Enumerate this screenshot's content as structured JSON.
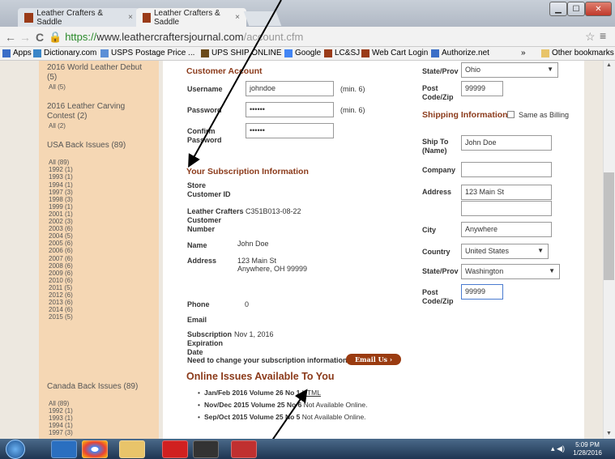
{
  "browser": {
    "tabs": [
      {
        "title": "Leather Crafters & Saddle",
        "close": "×"
      },
      {
        "title": "Leather Crafters & Saddle",
        "close": "×"
      }
    ],
    "nav": {
      "back": "←",
      "forward": "→",
      "reload": "C"
    },
    "url": {
      "scheme": "https://",
      "host": "www.leathercraftersjournal.com",
      "path": "/account.cfm"
    },
    "star": "☆",
    "menu": "≡",
    "bookmarks": [
      {
        "label": "Apps",
        "icon": "apps-icon"
      },
      {
        "label": "Dictionary.com",
        "icon": "dictionary-icon"
      },
      {
        "label": "USPS Postage Price ...",
        "icon": "usps-icon"
      },
      {
        "label": "UPS SHIP ONLINE",
        "icon": "ups-icon"
      },
      {
        "label": "Google",
        "icon": "google-icon"
      },
      {
        "label": "LC&SJ",
        "icon": "lcsj-icon"
      },
      {
        "label": "Web Cart Login",
        "icon": "webcart-icon"
      },
      {
        "label": "Authorize.net",
        "icon": "authorize-icon"
      }
    ],
    "bookmark_overflow": "»",
    "other_bookmarks": "Other bookmarks"
  },
  "sidebar": {
    "groups": [
      {
        "title": "2016 World Leather Debut (5)",
        "items": [
          "All (5)"
        ]
      },
      {
        "title": "2016 Leather Carving Contest (2)",
        "items": [
          "All (2)"
        ]
      },
      {
        "title": "USA Back Issues (89)",
        "items": [
          "All (89)",
          "1992 (1)",
          "1993 (1)",
          "1994 (1)",
          "1997 (3)",
          "1998 (3)",
          "1999 (1)",
          "2001 (1)",
          "2002 (3)",
          "2003 (6)",
          "2004 (5)",
          "2005 (6)",
          "2006 (6)",
          "2007 (6)",
          "2008 (6)",
          "2009 (6)",
          "2010 (6)",
          "2011 (5)",
          "2012 (6)",
          "2013 (6)",
          "2014 (6)",
          "2015 (5)"
        ]
      },
      {
        "title": "Canada Back Issues (89)",
        "items": [
          "All (89)",
          "1992 (1)",
          "1993 (1)",
          "1994 (1)",
          "1997 (3)"
        ]
      }
    ]
  },
  "account": {
    "heading": "Customer Account",
    "username_label": "Username",
    "username_value": "johndoe",
    "username_hint": "(min. 6)",
    "password_label": "Password",
    "password_value": "••••••",
    "password_hint": "(min. 6)",
    "confirm_label": "Confirm Password",
    "confirm_value": "••••••"
  },
  "subscription": {
    "heading": "Your Subscription Information",
    "store_id_label": "Store Customer ID",
    "lc_number_label": "Leather Crafters Customer Number",
    "lc_number_value": "C351B013-08-22",
    "name_label": "Name",
    "name_value": "John Doe",
    "address_label": "Address",
    "address_line1": "123 Main St",
    "address_line2": "Anywhere, OH  99999",
    "phone_label": "Phone",
    "phone_value": "0",
    "email_label": "Email",
    "expiration_label": "Subscription Expiration Date",
    "expiration_value": "Nov 1, 2016",
    "change_prompt": "Need to change your subscription information?",
    "email_button": "Email Us ›"
  },
  "online_issues": {
    "heading": "Online Issues Available To You",
    "items": [
      {
        "title": "Jan/Feb 2016 Volume 26 No 1",
        "status": "HTML",
        "is_link": true
      },
      {
        "title": "Nov/Dec 2015 Volume 25 No 6",
        "status": "Not Available Online.",
        "is_link": false
      },
      {
        "title": "Sep/Oct 2015 Volume 25 No 5",
        "status": "Not Available Online.",
        "is_link": false
      }
    ]
  },
  "billing": {
    "state_label": "State/Prov",
    "state_value": "Ohio",
    "postal_label": "Post Code/Zip",
    "postal_value": "99999"
  },
  "shipping": {
    "heading": "Shipping Information",
    "same_as_label": "Same as Billing",
    "ship_to_label": "Ship To (Name)",
    "ship_to_value": "John Doe",
    "company_label": "Company",
    "company_value": "",
    "address_label": "Address",
    "address_value": "123 Main St",
    "address2_value": "",
    "city_label": "City",
    "city_value": "Anywhere",
    "country_label": "Country",
    "country_value": "United States",
    "state_label": "State/Prov",
    "state_value": "Washington",
    "postal_label": "Post Code/Zip",
    "postal_value": "99999"
  },
  "taskbar": {
    "clock_time": "5:09 PM",
    "clock_date": "1/28/2016"
  },
  "colors": {
    "accent": "#8b3a1a",
    "sidebar_bg": "#f5d7b4",
    "button": "#9a3b10"
  }
}
